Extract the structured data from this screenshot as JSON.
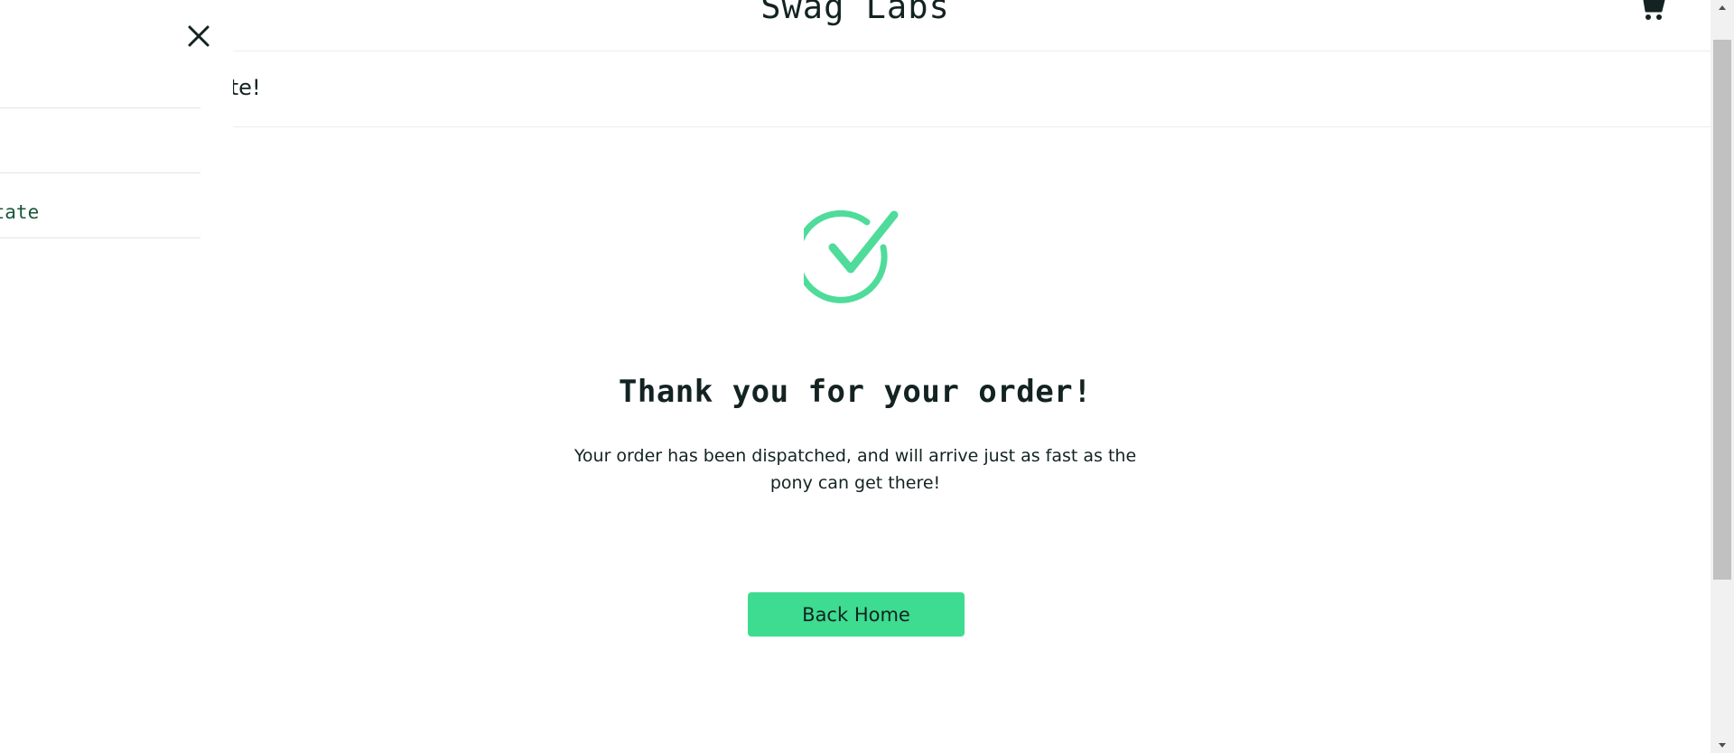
{
  "header": {
    "logo": "Swag Labs",
    "cart_icon": "shopping-cart-icon"
  },
  "secondary_header": {
    "title": "ete!"
  },
  "side_menu": {
    "close_icon": "close-icon",
    "items": [
      {
        "label": ""
      },
      {
        "label": ""
      },
      {
        "label": "State"
      }
    ]
  },
  "checkout_complete": {
    "icon": "checkmark-circle-icon",
    "header": "Thank you for your order!",
    "text": "Your order has been dispatched, and will arrive just as fast as the pony can get there!",
    "button_label": "Back Home"
  },
  "colors": {
    "accent": "#3ddc91",
    "check_icon": "#4fdc9a",
    "text": "#132322",
    "menu_text": "#18583a"
  },
  "scrollbar": {
    "up_icon": "arrow-up-icon",
    "down_icon": "arrow-down-icon"
  }
}
